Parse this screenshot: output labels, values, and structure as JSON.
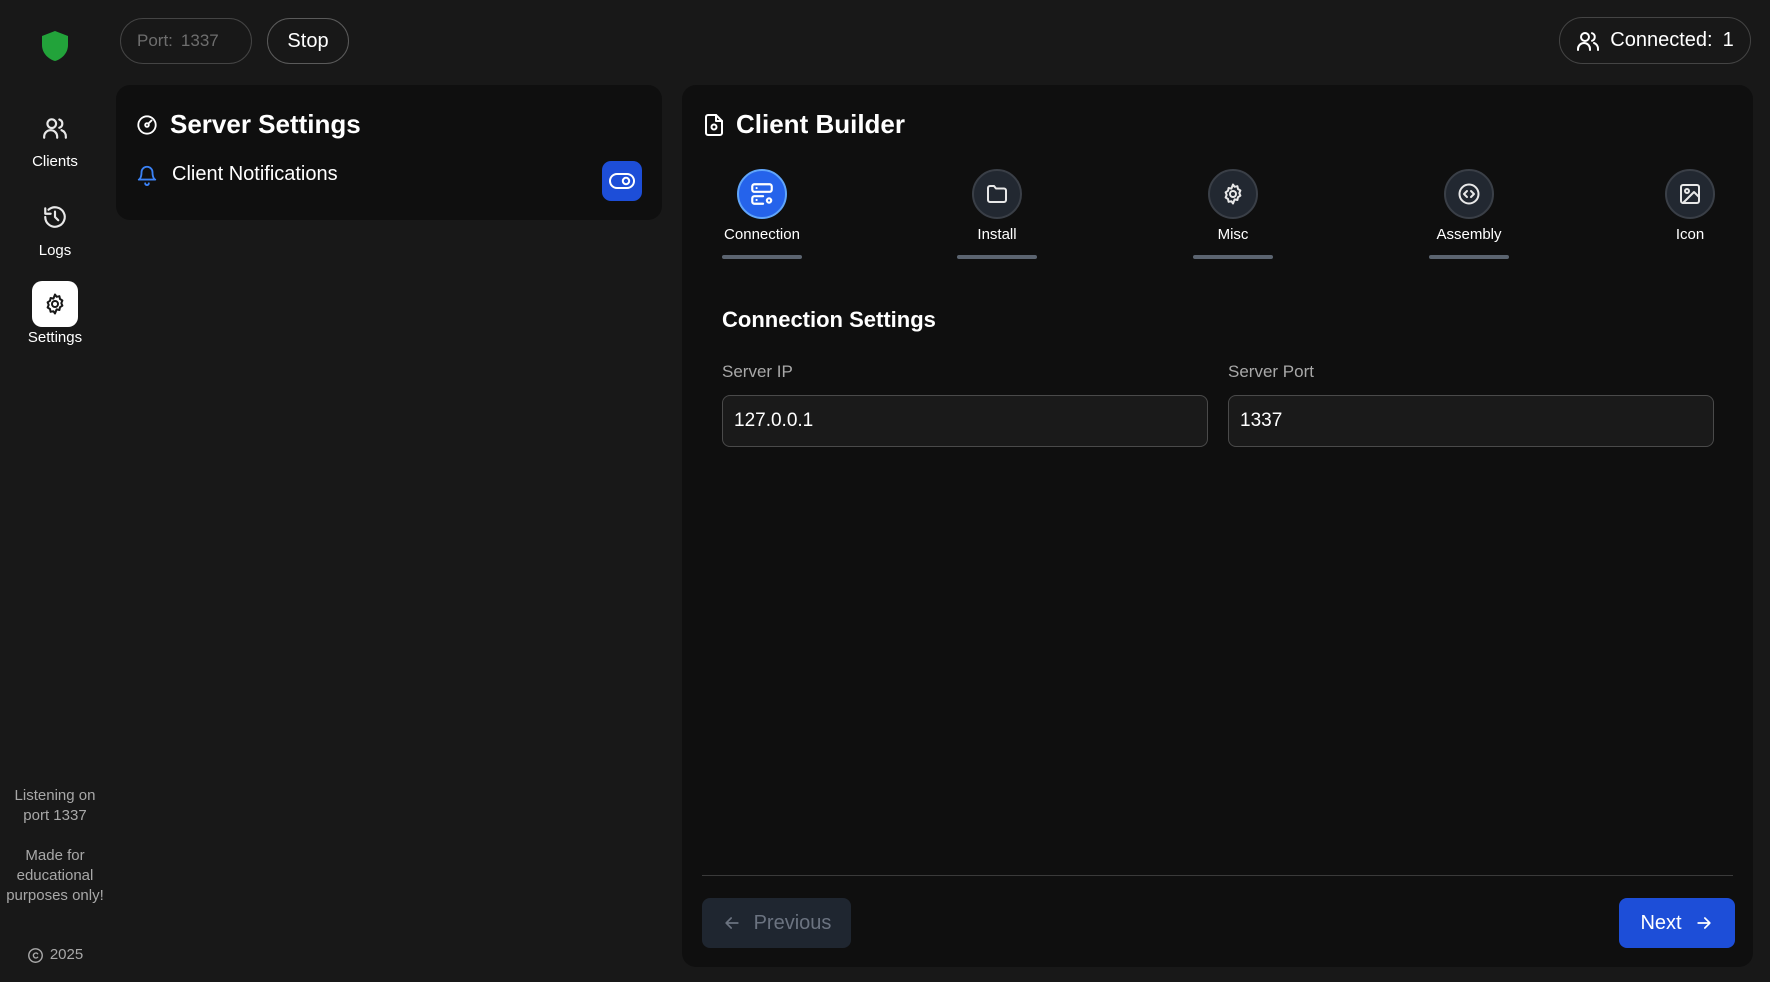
{
  "colors": {
    "background": "#181818",
    "panel": "#0f0f0f",
    "accent": "#1d4ed8",
    "logo": "#22a33a",
    "muted_text": "#a8a8a8"
  },
  "sidebar": {
    "logo_icon": "shield-icon",
    "items": [
      {
        "label": "Clients",
        "icon": "users-icon",
        "active": false
      },
      {
        "label": "Logs",
        "icon": "history-icon",
        "active": false
      },
      {
        "label": "Settings",
        "icon": "gear-icon",
        "active": true
      }
    ],
    "footer": {
      "listening": "Listening on port 1337",
      "disclaimer": "Made for educational purposes only!",
      "year": "2025"
    }
  },
  "topbar": {
    "port_label": "Port:",
    "port_value": "1337",
    "stop_label": "Stop",
    "connected_label": "Connected:",
    "connected_count": "1"
  },
  "server_settings": {
    "title": "Server Settings",
    "notifications_label": "Client Notifications",
    "notifications_enabled": true
  },
  "client_builder": {
    "title": "Client Builder",
    "steps": [
      {
        "label": "Connection",
        "icon": "server-gear-icon",
        "active": true
      },
      {
        "label": "Install",
        "icon": "folder-icon",
        "active": false
      },
      {
        "label": "Misc",
        "icon": "gear-icon",
        "active": false
      },
      {
        "label": "Assembly",
        "icon": "code-circle-icon",
        "active": false
      },
      {
        "label": "Icon",
        "icon": "image-icon",
        "active": false
      }
    ],
    "section_title": "Connection Settings",
    "server_ip_label": "Server IP",
    "server_ip_value": "127.0.0.1",
    "server_port_label": "Server Port",
    "server_port_value": "1337",
    "previous_label": "Previous",
    "next_label": "Next"
  }
}
